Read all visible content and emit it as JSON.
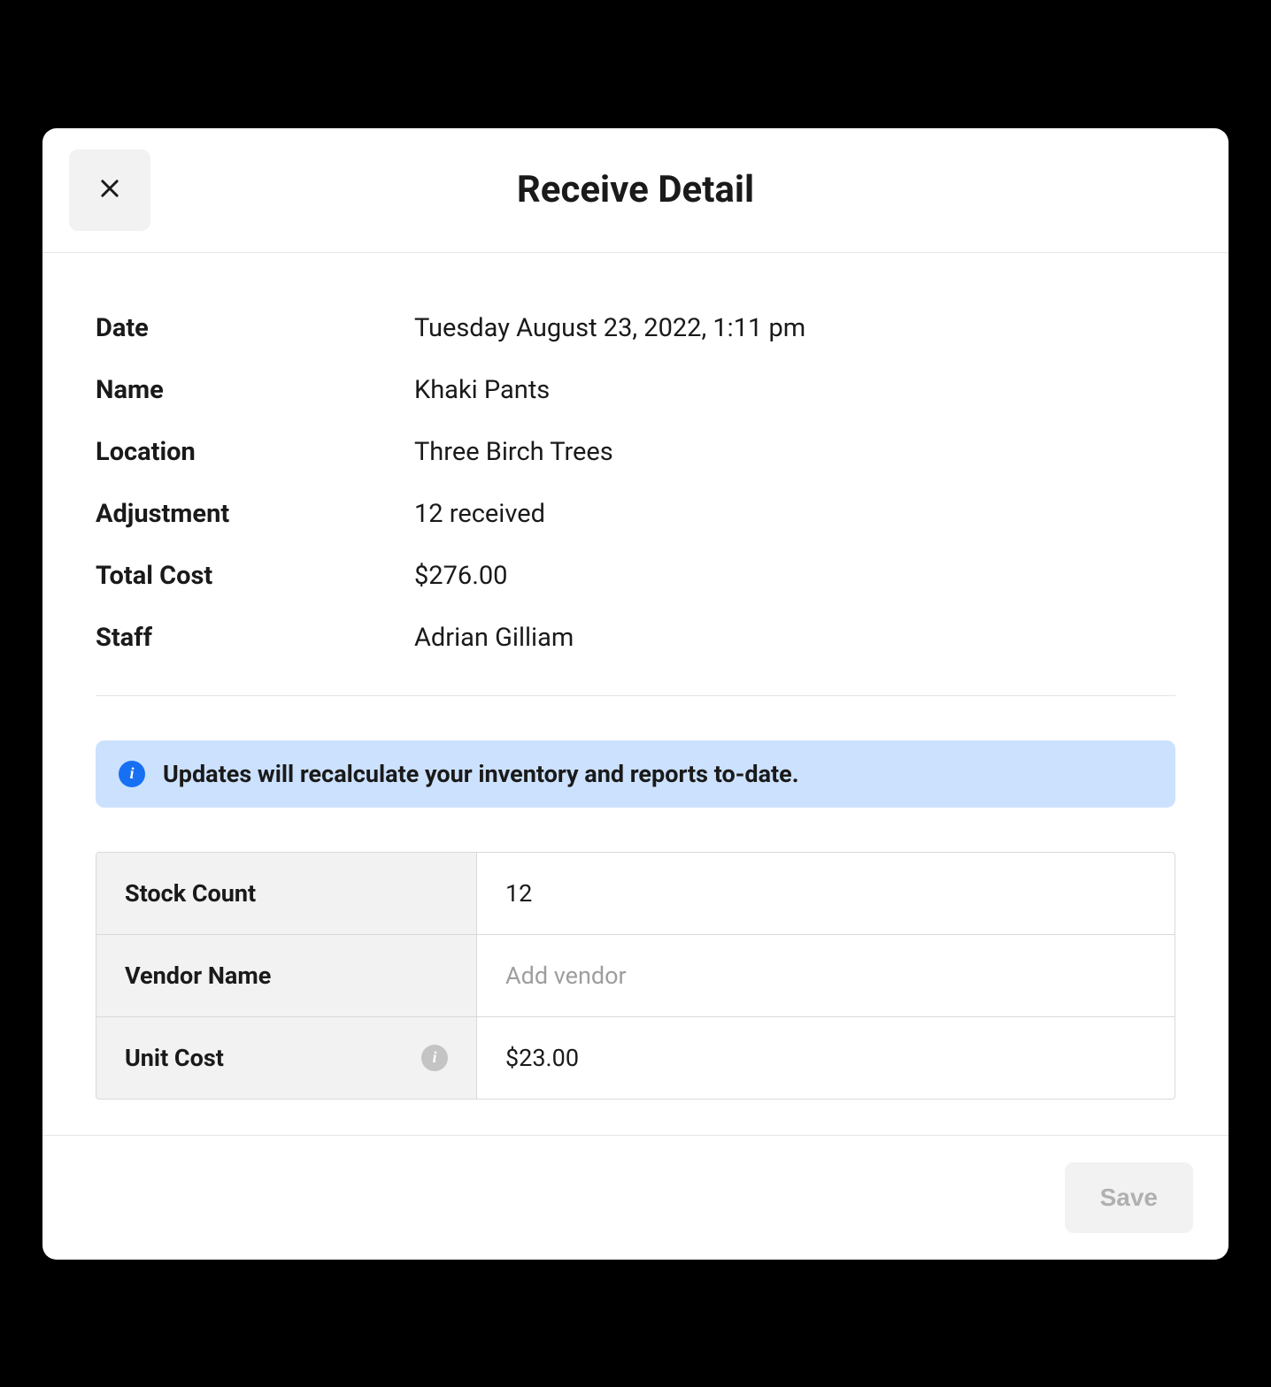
{
  "header": {
    "title": "Receive Detail"
  },
  "details": {
    "date_label": "Date",
    "date_value": "Tuesday August 23, 2022, 1:11 pm",
    "name_label": "Name",
    "name_value": "Khaki Pants",
    "location_label": "Location",
    "location_value": "Three Birch Trees",
    "adjustment_label": "Adjustment",
    "adjustment_value": "12 received",
    "total_cost_label": "Total Cost",
    "total_cost_value": "$276.00",
    "staff_label": "Staff",
    "staff_value": "Adrian Gilliam"
  },
  "banner": {
    "text": "Updates will recalculate your inventory and reports to-date."
  },
  "form": {
    "stock_count_label": "Stock Count",
    "stock_count_value": "12",
    "vendor_name_label": "Vendor Name",
    "vendor_name_value": "",
    "vendor_name_placeholder": "Add vendor",
    "unit_cost_label": "Unit Cost",
    "unit_cost_value": "$23.00"
  },
  "footer": {
    "save_label": "Save"
  }
}
